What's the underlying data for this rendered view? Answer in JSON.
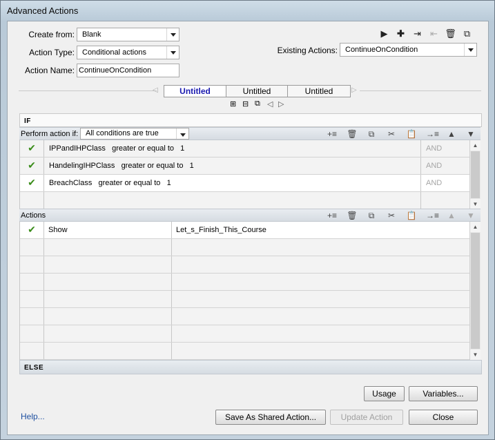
{
  "window": {
    "title": "Advanced Actions"
  },
  "form": {
    "create_from_label": "Create from:",
    "create_from_value": "Blank",
    "action_type_label": "Action Type:",
    "action_type_value": "Conditional actions",
    "action_name_label": "Action Name:",
    "action_name_value": "ContinueOnCondition",
    "existing_actions_label": "Existing Actions:",
    "existing_actions_value": "ContinueOnCondition"
  },
  "toolbar_icons": [
    "preview-icon",
    "add-icon",
    "import-icon",
    "export-icon",
    "delete-icon",
    "duplicate-icon"
  ],
  "tabs": [
    "Untitled",
    "Untitled",
    "Untitled"
  ],
  "if_section": {
    "header": "IF",
    "perform_label": "Perform action if:",
    "perform_value": "All conditions are true",
    "conditions": [
      {
        "variable": "IPPandIHPClass",
        "operator": "greater or equal to",
        "value": "1",
        "logic": "AND"
      },
      {
        "variable": "HandelingIHPClass",
        "operator": "greater or equal to",
        "value": "1",
        "logic": "AND"
      },
      {
        "variable": "BreachClass",
        "operator": "greater or equal to",
        "value": "1",
        "logic": "AND"
      }
    ]
  },
  "actions_section": {
    "label": "Actions",
    "rows": [
      {
        "action": "Show",
        "target": "Let_s_Finish_This_Course"
      }
    ]
  },
  "else_section": {
    "header": "ELSE"
  },
  "buttons": {
    "usage": "Usage",
    "variables": "Variables...",
    "help": "Help...",
    "save_shared": "Save As Shared Action...",
    "update": "Update Action",
    "close": "Close"
  },
  "colors": {
    "checkmark": "#3a8c1a",
    "selected_tab": "#1a1ab0",
    "link": "#1d4fa0"
  }
}
